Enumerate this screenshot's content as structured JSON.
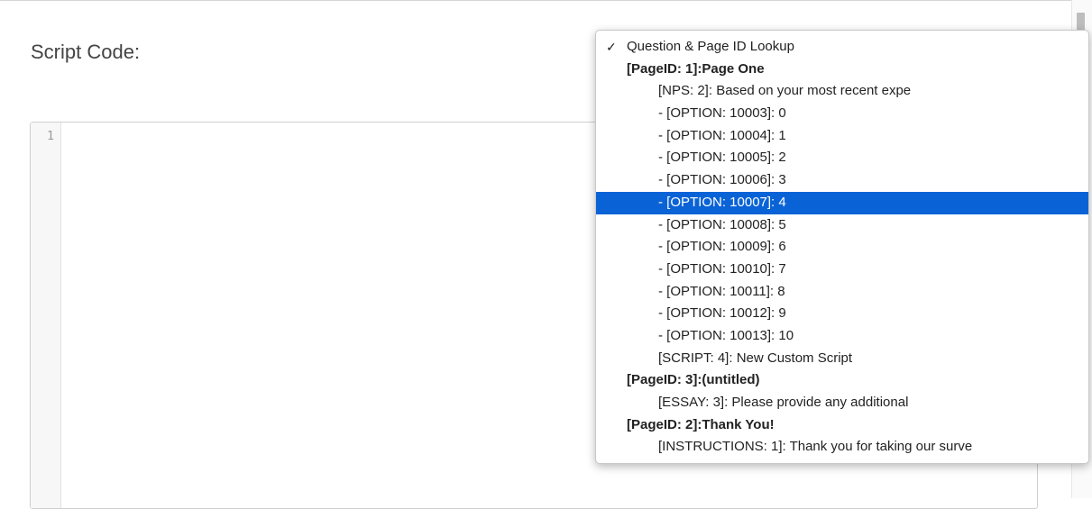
{
  "script_label": "Script Code:",
  "editor": {
    "line_number": "1"
  },
  "dropdown": {
    "check_mark": "✓",
    "items": [
      {
        "label": "Question & Page ID Lookup"
      },
      {
        "label": "[PageID: 1]:Page One"
      },
      {
        "label": "[NPS: 2]: Based on your most recent expe"
      },
      {
        "label": "- [OPTION: 10003]: 0"
      },
      {
        "label": "- [OPTION: 10004]: 1"
      },
      {
        "label": "- [OPTION: 10005]: 2"
      },
      {
        "label": "- [OPTION: 10006]: 3"
      },
      {
        "label": "- [OPTION: 10007]: 4"
      },
      {
        "label": "- [OPTION: 10008]: 5"
      },
      {
        "label": "- [OPTION: 10009]: 6"
      },
      {
        "label": "- [OPTION: 10010]: 7"
      },
      {
        "label": "- [OPTION: 10011]: 8"
      },
      {
        "label": "- [OPTION: 10012]: 9"
      },
      {
        "label": "- [OPTION: 10013]: 10"
      },
      {
        "label": "[SCRIPT: 4]: New Custom Script"
      },
      {
        "label": "[PageID: 3]:(untitled)"
      },
      {
        "label": "[ESSAY: 3]: Please provide any additional"
      },
      {
        "label": "[PageID: 2]:Thank You!"
      },
      {
        "label": "[INSTRUCTIONS: 1]: Thank you for taking our surve"
      }
    ]
  },
  "colors": {
    "selection": "#0a63d6"
  }
}
